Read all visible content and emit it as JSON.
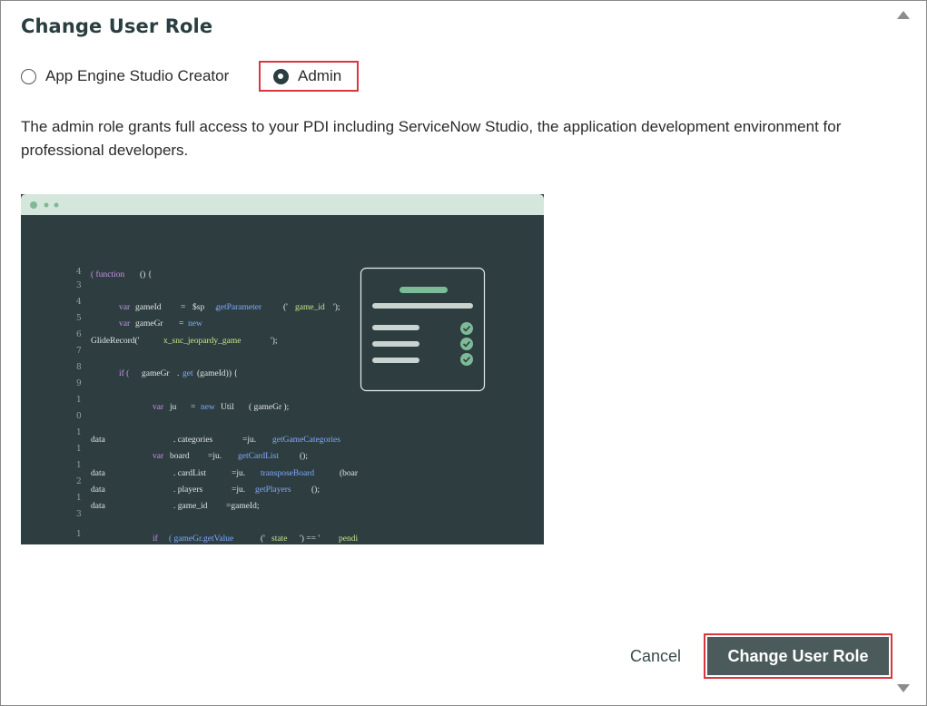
{
  "dialog": {
    "title": "Change User Role"
  },
  "role_options": [
    {
      "label": "App Engine Studio Creator",
      "checked": false
    },
    {
      "label": "Admin",
      "checked": true
    }
  ],
  "description": "The admin role grants full access to your PDI including ServiceNow Studio, the application development environment for professional developers.",
  "illustration": {
    "line_numbers": [
      "4",
      "3",
      "4",
      "5",
      "6",
      "7",
      "8",
      "9",
      "1",
      "0",
      "1",
      "1",
      "1",
      "2",
      "1",
      "3",
      "1"
    ],
    "code_lines": [
      [
        "( function",
        "() {"
      ],
      [
        "var",
        "gameId",
        "=",
        "$sp",
        ".",
        "getParameter",
        "('",
        "game_id",
        "');"
      ],
      [
        "var",
        "gameGr",
        "=",
        "new"
      ],
      [
        "GlideRecord('",
        "x_snc_jeopardy_game",
        "');"
      ],
      [
        "if (",
        "gameGr",
        ".",
        "get",
        "(gameId)) {"
      ],
      [
        "var",
        "ju",
        "=",
        "new",
        "Util",
        "( gameGr );"
      ],
      [
        "data",
        ". categories",
        "=ju.",
        "getGameCategories"
      ],
      [
        "var",
        "board",
        "=ju.",
        "getCardList",
        "();"
      ],
      [
        "data",
        ". cardList",
        "=ju.",
        "transposeBoard",
        "(boar"
      ],
      [
        "data",
        ". players",
        "=ju.",
        "getPlayers",
        "();"
      ],
      [
        "data",
        ". game_id",
        "=gameId;"
      ],
      [
        "if",
        "( gameGr.getValue",
        "('",
        "state",
        "') == '",
        "pendi"
      ]
    ],
    "colors": {
      "editor_bg": "#2e3d40",
      "titlebar_bg": "#d5e6dc",
      "accent_green": "#7dbb96",
      "keyword": "#c792ea",
      "function": "#82aaff",
      "string": "#c3e88d",
      "text": "#dfe6e4"
    }
  },
  "actions": {
    "cancel_label": "Cancel",
    "submit_label": "Change User Role"
  },
  "scrollbar": {
    "up_icon": "triangle-up-icon",
    "down_icon": "triangle-down-icon"
  },
  "highlight_color": "#d9363e"
}
